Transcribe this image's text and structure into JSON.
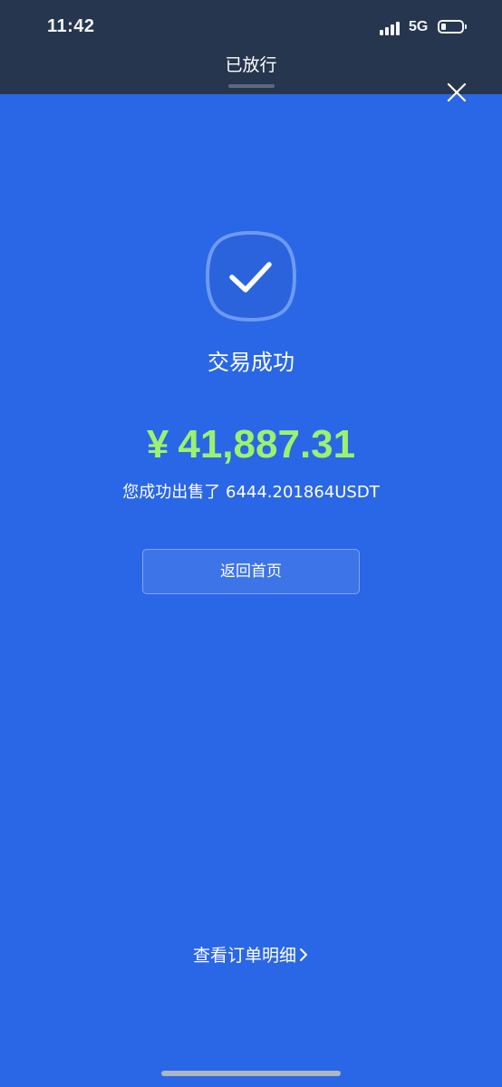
{
  "status_bar": {
    "time": "11:42",
    "network": "5G",
    "signal_icon": "cellular-signal-icon",
    "battery_icon": "battery-icon",
    "battery_level": 0.25
  },
  "sheet": {
    "title": "已放行",
    "close_icon": "close-icon"
  },
  "result": {
    "icon": "checkmark-icon",
    "title": "交易成功",
    "currency_symbol": "¥",
    "amount": "41,887.31",
    "detail": "您成功出售了 6444.201864USDT"
  },
  "actions": {
    "home_label": "返回首页",
    "order_link_label": "查看订单明细",
    "order_link_icon": "chevron-right-icon"
  },
  "colors": {
    "background": "#2A67E6",
    "sheet_header": "#27364F",
    "amount": "#9BF26E"
  }
}
